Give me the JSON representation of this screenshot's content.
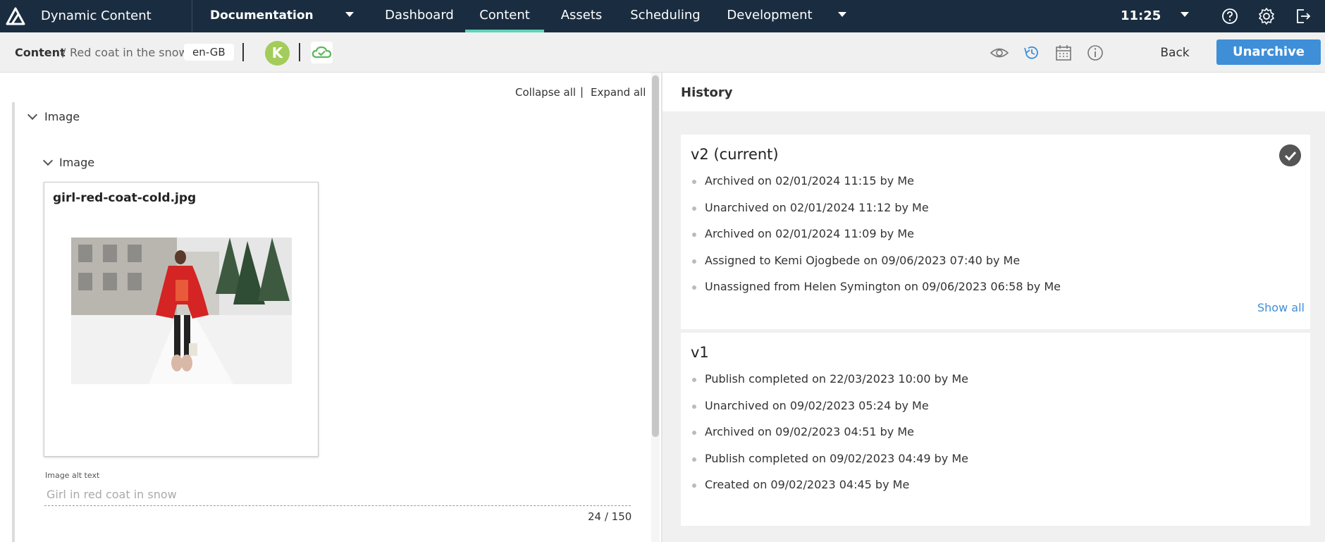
{
  "topnav": {
    "app_title": "Dynamic Content",
    "hub": "Documentation",
    "tabs": [
      "Dashboard",
      "Content",
      "Assets",
      "Scheduling",
      "Development"
    ],
    "active_tab": "Content",
    "clock": "11:25",
    "icons": [
      "help-icon",
      "settings-icon",
      "logout-icon"
    ]
  },
  "toolbar": {
    "breadcrumb_root": "Content",
    "breadcrumb_sep": "/",
    "breadcrumb_item": "Red coat in the snow",
    "locale": "en-GB",
    "avatar_initial": "K",
    "back_label": "Back",
    "unarchive_label": "Unarchive"
  },
  "editor": {
    "collapse_all": "Collapse all",
    "separator": "|",
    "expand_all": "Expand all",
    "section_label": "Image",
    "subsection_label": "Image",
    "file_name": "girl-red-coat-cold.jpg",
    "alt_text_label": "Image alt text",
    "alt_text_value": "Girl in red coat in snow",
    "char_count": "24 / 150"
  },
  "history": {
    "title": "History",
    "versions": [
      {
        "title": "v2 (current)",
        "current": true,
        "events": [
          "Archived on 02/01/2024 11:15 by Me",
          "Unarchived on 02/01/2024 11:12 by Me",
          "Archived on 02/01/2024 11:09 by Me",
          "Assigned to Kemi Ojogbede on 09/06/2023 07:40 by Me",
          "Unassigned from Helen Symington on 09/06/2023 06:58 by Me"
        ],
        "show_all": "Show all"
      },
      {
        "title": "v1",
        "current": false,
        "events": [
          "Publish completed on 22/03/2023 10:00 by Me",
          "Unarchived on 09/02/2023 05:24 by Me",
          "Archived on 09/02/2023 04:51 by Me",
          "Publish completed on 09/02/2023 04:49 by Me",
          "Created on 09/02/2023 04:45 by Me"
        ]
      }
    ]
  },
  "colors": {
    "nav_bg": "#1a2d40",
    "active_tab_underline": "#5ed3b7",
    "primary_button": "#3e8fd8",
    "avatar": "#a3cc5a",
    "sync_icon": "#5cb85c"
  }
}
